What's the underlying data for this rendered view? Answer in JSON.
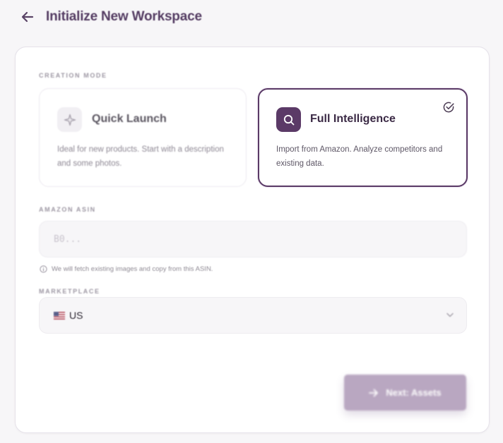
{
  "header": {
    "back_label": "Back",
    "title": "Initialize New Workspace"
  },
  "creation_mode": {
    "label": "CREATION MODE",
    "options": [
      {
        "title": "Quick Launch",
        "description": "Ideal for new products. Start with a description and some photos.",
        "icon": "sparkle-icon",
        "selected": false
      },
      {
        "title": "Full Intelligence",
        "description": "Import from Amazon. Analyze competitors and existing data.",
        "icon": "search-icon",
        "selected": true
      }
    ]
  },
  "asin": {
    "label": "AMAZON ASIN",
    "placeholder": "B0...",
    "value": "",
    "hint": "We will fetch existing images and copy from this ASIN."
  },
  "marketplace": {
    "label": "MARKETPLACE",
    "selected": "US",
    "flag_icon": "us-flag-icon"
  },
  "actions": {
    "next_label": "Next: Assets"
  },
  "colors": {
    "accent": "#5b3a67",
    "accent_muted": "#b9a7c1",
    "background": "#f7f6f8"
  }
}
